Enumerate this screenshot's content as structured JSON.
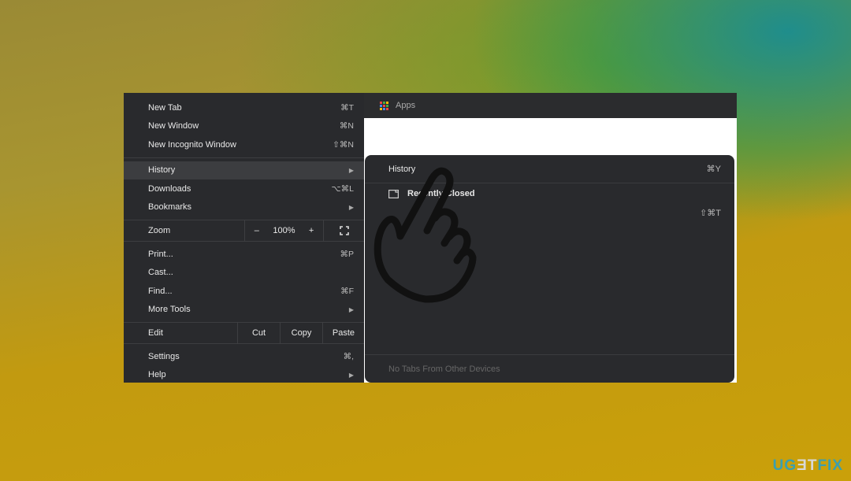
{
  "browser": {
    "bookmarks_bar": {
      "apps_label": "Apps"
    }
  },
  "menu": {
    "items": [
      {
        "label": "New Tab",
        "shortcut": "⌘T"
      },
      {
        "label": "New Window",
        "shortcut": "⌘N"
      },
      {
        "label": "New Incognito Window",
        "shortcut": "⇧⌘N"
      },
      {
        "label": "History",
        "submenu": true,
        "highlighted": true
      },
      {
        "label": "Downloads",
        "shortcut": "⌥⌘L"
      },
      {
        "label": "Bookmarks",
        "submenu": true
      }
    ],
    "zoom": {
      "label": "Zoom",
      "minus": "–",
      "value": "100%",
      "plus": "+",
      "fullscreen_icon": "fullscreen-icon"
    },
    "items2": [
      {
        "label": "Print...",
        "shortcut": "⌘P"
      },
      {
        "label": "Cast..."
      },
      {
        "label": "Find...",
        "shortcut": "⌘F"
      },
      {
        "label": "More Tools",
        "submenu": true
      }
    ],
    "edit": {
      "label": "Edit",
      "cut": "Cut",
      "copy": "Copy",
      "paste": "Paste"
    },
    "items3": [
      {
        "label": "Settings",
        "shortcut": "⌘,"
      },
      {
        "label": "Help",
        "submenu": true
      }
    ]
  },
  "history_submenu": {
    "title": "History",
    "title_shortcut": "⌘Y",
    "recently_closed": "Recently Closed",
    "reopen_shortcut": "⇧⌘T",
    "other_devices": "No Tabs From Other Devices"
  },
  "watermark": {
    "text_a": "UG",
    "text_b": "E",
    "text_c": "T",
    "text_d": "FIX"
  },
  "colors": {
    "menu_bg": "#292a2d",
    "highlight": "#3c3d40"
  }
}
